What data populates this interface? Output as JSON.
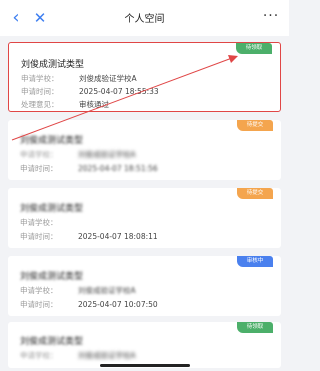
{
  "navbar": {
    "title": "个人空间",
    "back_glyph": "‹",
    "close_glyph": "✕",
    "more_glyph": "···"
  },
  "labels": {
    "school": "申请学校：",
    "time": "申请时间：",
    "opinion": "处理意见："
  },
  "cards": [
    {
      "title": "刘俊成测试类型",
      "status": "待领取",
      "school": "刘俊成验证学校A",
      "time": "2025-04-07 18:55:33",
      "opinion": "审核通过"
    },
    {
      "title": "刘俊成测试类型",
      "status": "待提交",
      "school": "刘俊成验证学校A",
      "time": "2025-04-07 18:51:56"
    },
    {
      "title": "刘俊成测试类型",
      "status": "待提交",
      "school": "",
      "time": "2025-04-07 18:08:11"
    },
    {
      "title": "刘俊成测试类型",
      "status": "审核中",
      "school": "刘俊成验证学校A",
      "time": "2025-04-07 10:07:50"
    },
    {
      "title": "刘俊成测试类型",
      "status": "待领取",
      "school": "刘俊成验证学校A"
    }
  ],
  "colors": {
    "accent": "#3d7ef0",
    "highlight_border": "#e04646",
    "tag_pending": "#4caf6a",
    "tag_returned": "#f4a54e",
    "tag_reviewing": "#4a80ee"
  }
}
